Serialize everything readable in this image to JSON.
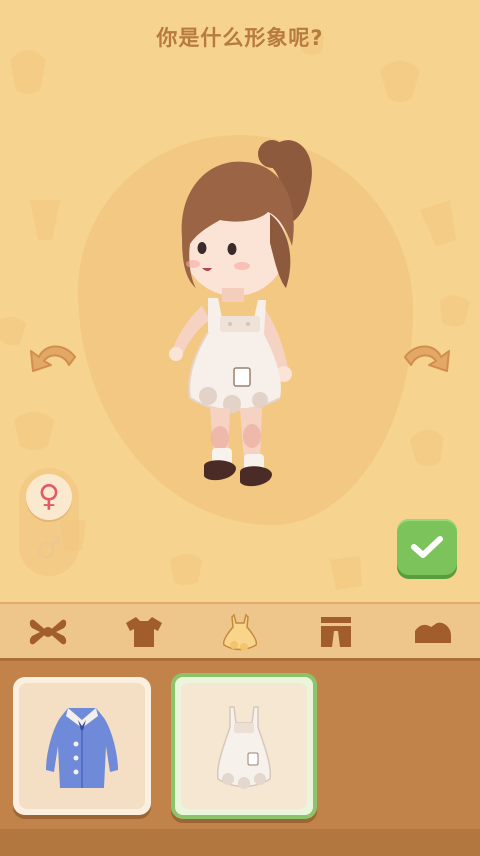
{
  "header": {
    "title": "你是什么形象呢?"
  },
  "controls": {
    "rotate_left_icon": "rotate-left-arrow",
    "rotate_right_icon": "rotate-right-arrow",
    "confirm_icon": "checkmark",
    "gender_female_symbol": "♀",
    "gender_male_symbol": "♂",
    "gender_selected": "female"
  },
  "tabs": [
    {
      "icon": "hair-bow-icon",
      "selected": false
    },
    {
      "icon": "shirt-icon",
      "selected": false
    },
    {
      "icon": "dress-icon",
      "selected": true
    },
    {
      "icon": "pants-icon",
      "selected": false
    },
    {
      "icon": "shoes-icon",
      "selected": false
    }
  ],
  "items": [
    {
      "icon": "blue-coat-icon",
      "selected": false
    },
    {
      "icon": "white-dress-icon",
      "selected": true
    }
  ],
  "colors": {
    "background": "#f6d38f",
    "accent_green": "#7bc35a",
    "female_pink": "#e05b6a",
    "tab_active": "#f8d58a",
    "tab_inactive": "#a25d2c",
    "panel_brown": "#c1834a"
  }
}
